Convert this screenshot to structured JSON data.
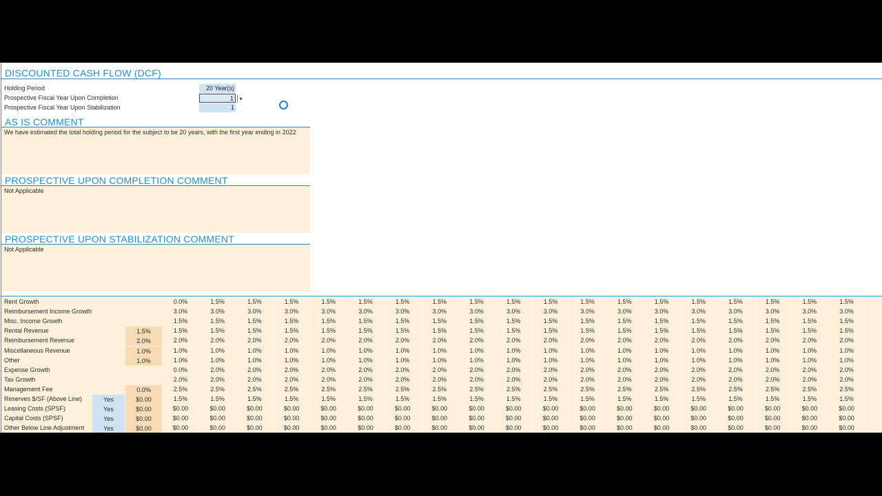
{
  "title": "DISCOUNTED CASH FLOW (DCF)",
  "inputs": {
    "holding_period_label": "Holding Period",
    "holding_period_value": "20 Year(s)",
    "completion_label": "Prospective Fiscal Year Upon Completion",
    "completion_value": "1",
    "stabilization_label": "Prospective Fiscal Year Upon Stabilization",
    "stabilization_value": "1"
  },
  "comments": {
    "as_is_title": "AS IS COMMENT",
    "as_is_text": "We have estimated the total holding period for the subject to be 20 years, with the first year ending in 2022",
    "completion_title": "PROSPECTIVE UPON COMPLETION COMMENT",
    "completion_text": "Not Applicable",
    "stabilization_title": "PROSPECTIVE UPON STABILIZATION COMMENT",
    "stabilization_text": "Not Applicable"
  },
  "growth_rows": [
    {
      "label": "Rent Growth",
      "flag": "",
      "pre": "",
      "first": "0.0%",
      "rest": "1.5%"
    },
    {
      "label": "Reimbursement Income Growth",
      "flag": "",
      "pre": "",
      "first": "3.0%",
      "rest": "3.0%"
    },
    {
      "label": "Misc. Income Growth",
      "flag": "",
      "pre": "",
      "first": "1.5%",
      "rest": "1.5%"
    },
    {
      "label": "Rental Revenue",
      "flag": "",
      "pre": "1.5%",
      "first": "1.5%",
      "rest": "1.5%"
    },
    {
      "label": "Reimbursement Revenue",
      "flag": "",
      "pre": "2.0%",
      "first": "2.0%",
      "rest": "2.0%"
    },
    {
      "label": "Miscellaneous Revenue",
      "flag": "",
      "pre": "1.0%",
      "first": "1.0%",
      "rest": "1.0%"
    },
    {
      "label": "Other",
      "flag": "",
      "pre": "1.0%",
      "first": "1.0%",
      "rest": "1.0%"
    },
    {
      "label": "Expense Growth",
      "flag": "",
      "pre": "",
      "first": "0.0%",
      "rest": "2.0%"
    },
    {
      "label": "Tax Growth",
      "flag": "",
      "pre": "",
      "first": "2.0%",
      "rest": "2.0%"
    },
    {
      "label": "Management Fee",
      "flag": "",
      "pre": "0.0%",
      "first": "2.5%",
      "rest": "2.5%"
    },
    {
      "label": "Reserves $/SF (Above Line)",
      "flag": "Yes",
      "pre": "$0.00",
      "first": "1.5%",
      "rest": "1.5%"
    },
    {
      "label": "Leasing Costs (SPSF)",
      "flag": "Yes",
      "pre": "$0.00",
      "first": "$0.00",
      "rest": "$0.00"
    },
    {
      "label": "Capital Costs (SPSF)",
      "flag": "Yes",
      "pre": "$0.00",
      "first": "$0.00",
      "rest": "$0.00"
    },
    {
      "label": "Other Below Line Adjustment",
      "flag": "Yes",
      "pre": "$0.00",
      "first": "$0.00",
      "rest": "$0.00"
    }
  ],
  "year_columns": 19,
  "colors": {
    "accent": "#1f8fd0",
    "input_fill": "#cfe3f3",
    "comment_fill": "#fdf1dc"
  }
}
